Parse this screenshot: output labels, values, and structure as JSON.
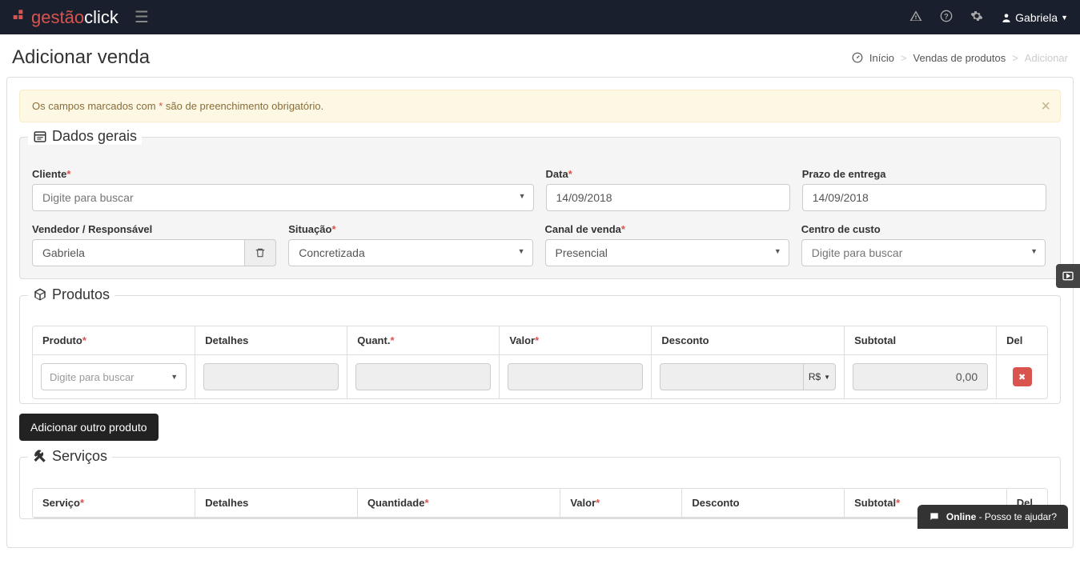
{
  "navbar": {
    "logo_part1": "gestão",
    "logo_part2": "click",
    "user_name": "Gabriela"
  },
  "page": {
    "title": "Adicionar venda",
    "breadcrumb": {
      "home": "Início",
      "section": "Vendas de produtos",
      "current": "Adicionar"
    }
  },
  "alert": {
    "text_before": "Os campos marcados com ",
    "text_after": " são de preenchimento obrigatório."
  },
  "sections": {
    "dados_gerais": {
      "legend": "Dados gerais",
      "cliente": {
        "label": "Cliente",
        "placeholder": "Digite para buscar"
      },
      "data": {
        "label": "Data",
        "value": "14/09/2018"
      },
      "prazo": {
        "label": "Prazo de entrega",
        "value": "14/09/2018"
      },
      "vendedor": {
        "label": "Vendedor / Responsável",
        "value": "Gabriela"
      },
      "situacao": {
        "label": "Situação",
        "value": "Concretizada"
      },
      "canal": {
        "label": "Canal de venda",
        "value": "Presencial"
      },
      "centro_custo": {
        "label": "Centro de custo",
        "placeholder": "Digite para buscar"
      }
    },
    "produtos": {
      "legend": "Produtos",
      "headers": {
        "produto": "Produto",
        "detalhes": "Detalhes",
        "quant": "Quant.",
        "valor": "Valor",
        "desconto": "Desconto",
        "subtotal": "Subtotal",
        "del": "Del"
      },
      "row": {
        "produto_placeholder": "Digite para buscar",
        "desconto_unit": "R$",
        "subtotal_value": "0,00"
      },
      "add_button": "Adicionar outro produto"
    },
    "servicos": {
      "legend": "Serviços",
      "headers": {
        "servico": "Serviço",
        "detalhes": "Detalhes",
        "quantidade": "Quantidade",
        "valor": "Valor",
        "desconto": "Desconto",
        "subtotal": "Subtotal",
        "del": "Del"
      }
    }
  },
  "chat": {
    "status": "Online",
    "text": " - Posso te ajudar?"
  }
}
